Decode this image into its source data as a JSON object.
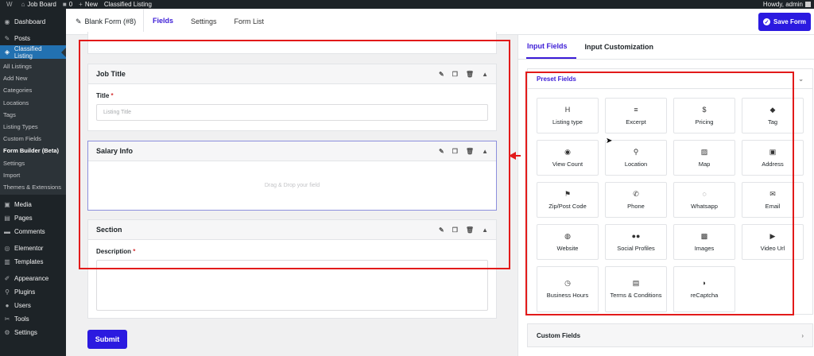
{
  "admin_bar": {
    "site_name": "Job Board",
    "comments_count": "0",
    "new_label": "New",
    "plugin_label": "Classified Listing",
    "howdy": "Howdy, admin"
  },
  "sidebar": {
    "top_items": [
      {
        "label": "Dashboard",
        "icon": "dashboard-icon"
      },
      {
        "label": "Posts",
        "icon": "pin-icon"
      },
      {
        "label": "Classified Listing",
        "icon": "listing-icon",
        "current": true
      }
    ],
    "submenu": [
      "All Listings",
      "Add New",
      "Categories",
      "Locations",
      "Tags",
      "Listing Types",
      "Custom Fields",
      "Form Builder (Beta)",
      "Settings",
      "Import",
      "Themes & Extensions"
    ],
    "bottom_items": [
      {
        "label": "Media",
        "icon": "media-icon"
      },
      {
        "label": "Pages",
        "icon": "pages-icon"
      },
      {
        "label": "Comments",
        "icon": "comments-icon"
      },
      {
        "label": "Elementor",
        "icon": "elementor-icon"
      },
      {
        "label": "Templates",
        "icon": "templates-icon"
      },
      {
        "label": "Appearance",
        "icon": "appearance-icon"
      },
      {
        "label": "Plugins",
        "icon": "plugins-icon"
      },
      {
        "label": "Users",
        "icon": "users-icon"
      },
      {
        "label": "Tools",
        "icon": "tools-icon"
      },
      {
        "label": "Settings",
        "icon": "settings-icon"
      }
    ]
  },
  "toolbar": {
    "form_name": "Blank Form (#8)",
    "tabs": [
      "Fields",
      "Settings",
      "Form List"
    ],
    "active_tab": "Fields",
    "save_label": "Save Form"
  },
  "builder": {
    "sections": [
      {
        "title": "Job Title",
        "field_label": "Title",
        "required": "*",
        "placeholder": "Listing Title"
      },
      {
        "title": "Salary Info",
        "drop_text": "Drag & Drop your field"
      },
      {
        "title": "Section",
        "field_label": "Description",
        "required": "*"
      }
    ],
    "submit_label": "Submit"
  },
  "right_panel": {
    "tabs": [
      "Input Fields",
      "Input Customization"
    ],
    "active_tab": "Input Fields",
    "preset_title": "Preset Fields",
    "preset_fields": [
      {
        "label": "Listing type",
        "icon": "heading-icon"
      },
      {
        "label": "Excerpt",
        "icon": "excerpt-icon"
      },
      {
        "label": "Pricing",
        "icon": "dollar-icon"
      },
      {
        "label": "Tag",
        "icon": "tag-icon"
      },
      {
        "label": "View Count",
        "icon": "eye-icon"
      },
      {
        "label": "Location",
        "icon": "location-pin-icon"
      },
      {
        "label": "Map",
        "icon": "map-icon"
      },
      {
        "label": "Address",
        "icon": "address-card-icon"
      },
      {
        "label": "Zip/Post Code",
        "icon": "map-pin-icon"
      },
      {
        "label": "Phone",
        "icon": "phone-icon"
      },
      {
        "label": "Whatsapp",
        "icon": "whatsapp-icon"
      },
      {
        "label": "Email",
        "icon": "email-icon"
      },
      {
        "label": "Website",
        "icon": "globe-icon"
      },
      {
        "label": "Social Profiles",
        "icon": "users-icon"
      },
      {
        "label": "Images",
        "icon": "image-icon"
      },
      {
        "label": "Video Url",
        "icon": "video-icon"
      },
      {
        "label": "Business Hours",
        "icon": "clock-icon"
      },
      {
        "label": "Terms & Conditions",
        "icon": "document-icon"
      },
      {
        "label": "reCaptcha",
        "icon": "shield-icon"
      }
    ],
    "custom_title": "Custom Fields"
  },
  "colors": {
    "accent": "#2b1ae0",
    "admin_dark": "#1d2327",
    "annotation_red": "#e21a1a"
  }
}
